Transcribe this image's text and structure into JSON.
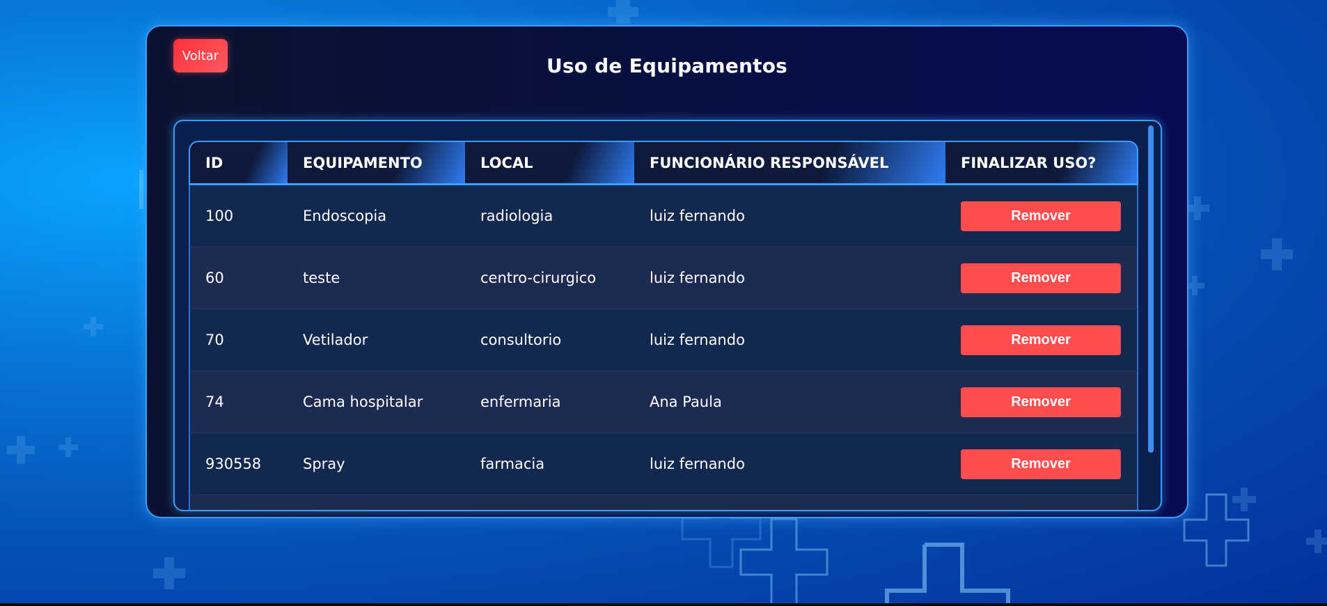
{
  "page": {
    "back_label": "Voltar",
    "title": "Uso de Equipamentos"
  },
  "table": {
    "headers": {
      "id": "ID",
      "equipamento": "EQUIPAMENTO",
      "local": "LOCAL",
      "funcionario": "FUNCIONÁRIO RESPONSÁVEL",
      "finalizar": "FINALIZAR USO?"
    },
    "rows": [
      {
        "id": "100",
        "equipamento": "Endoscopia",
        "local": "radiologia",
        "funcionario": "luiz fernando",
        "action": "Remover"
      },
      {
        "id": "60",
        "equipamento": "teste",
        "local": "centro-cirurgico",
        "funcionario": "luiz fernando",
        "action": "Remover"
      },
      {
        "id": "70",
        "equipamento": "Vetilador",
        "local": "consultorio",
        "funcionario": "luiz fernando",
        "action": "Remover"
      },
      {
        "id": "74",
        "equipamento": "Cama hospitalar",
        "local": "enfermaria",
        "funcionario": "Ana Paula",
        "action": "Remover"
      },
      {
        "id": "930558",
        "equipamento": "Spray",
        "local": "farmacia",
        "funcionario": "luiz fernando",
        "action": "Remover"
      }
    ]
  },
  "colors": {
    "accent": "#3a9dff",
    "danger": "#ff4d4f",
    "panel_bg": "#081040"
  },
  "icons": {
    "background_pattern": "medical-cross-icon"
  }
}
